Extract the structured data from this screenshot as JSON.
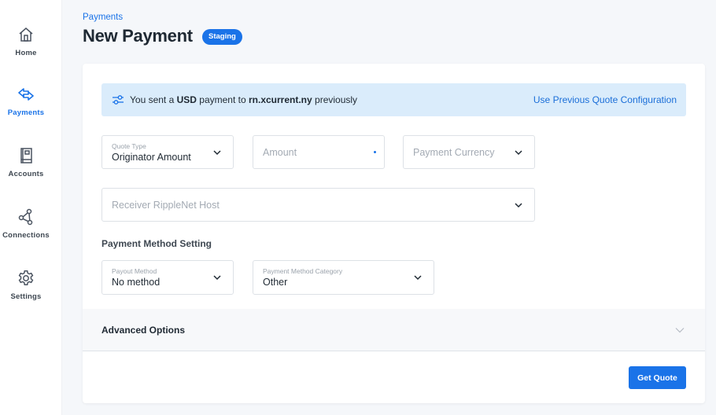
{
  "sidebar": {
    "items": [
      {
        "label": "Home",
        "icon": "home-icon",
        "active": false
      },
      {
        "label": "Payments",
        "icon": "transfer-arrows-icon",
        "active": true
      },
      {
        "label": "Accounts",
        "icon": "ledger-book-icon",
        "active": false
      },
      {
        "label": "Connections",
        "icon": "network-nodes-icon",
        "active": false
      },
      {
        "label": "Settings",
        "icon": "gear-icon",
        "active": false
      }
    ]
  },
  "header": {
    "breadcrumb": "Payments",
    "title": "New Payment",
    "badge": "Staging"
  },
  "banner": {
    "icon": "sliders-icon",
    "text_prefix": "You sent a ",
    "currency": "USD",
    "text_middle": " payment to ",
    "host": "rn.xcurrent.ny",
    "text_suffix": " previously",
    "link": "Use Previous Quote Configuration"
  },
  "form": {
    "quote_type": {
      "label": "Quote Type",
      "value": "Originator Amount"
    },
    "amount": {
      "placeholder": "Amount"
    },
    "payment_currency": {
      "placeholder": "Payment Currency"
    },
    "receiver_host": {
      "placeholder": "Receiver RippleNet Host"
    },
    "payment_method_section": "Payment Method Setting",
    "payout_method": {
      "label": "Payout Method",
      "value": "No method"
    },
    "payment_method_category": {
      "label": "Payment Method Category",
      "value": "Other"
    }
  },
  "advanced": {
    "label": "Advanced Options"
  },
  "actions": {
    "get_quote": "Get Quote"
  },
  "colors": {
    "accent": "#1a73e8",
    "banner_bg": "#daecfb"
  }
}
